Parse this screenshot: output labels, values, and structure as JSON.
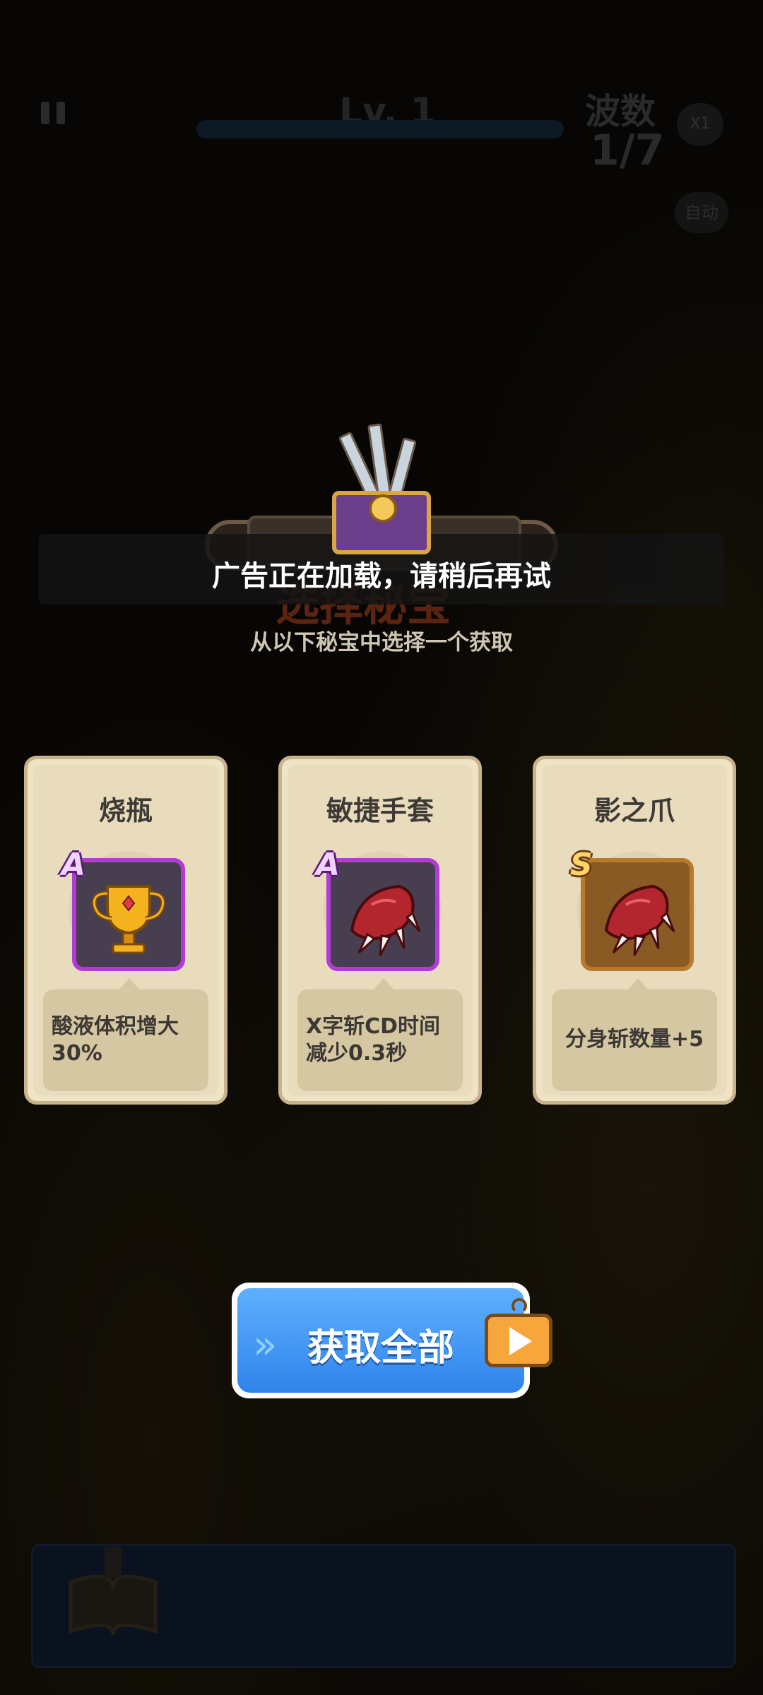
{
  "hud": {
    "level": "Lv. 1",
    "wave_label": "波数",
    "wave_count": "1/7",
    "speed": "X1",
    "auto": "自动"
  },
  "toast": "广告正在加载，请稍后再试",
  "title": "选择秘宝",
  "subtitle": "从以下秘宝中选择一个获取",
  "cards": [
    {
      "name": "烧瓶",
      "rank": "A",
      "icon": "trophy-icon",
      "desc": "酸液体积增大30%"
    },
    {
      "name": "敏捷手套",
      "rank": "A",
      "icon": "claw-icon",
      "desc": "X字斩CD时间减少0.3秒"
    },
    {
      "name": "影之爪",
      "rank": "S",
      "icon": "claw-icon",
      "desc": "分身斩数量+5"
    }
  ],
  "claim_all": "获取全部",
  "colors": {
    "rank_a": "#b23ad6",
    "rank_s": "#b87a2c",
    "button": "#3a90f0",
    "card": "#efe3c6"
  }
}
